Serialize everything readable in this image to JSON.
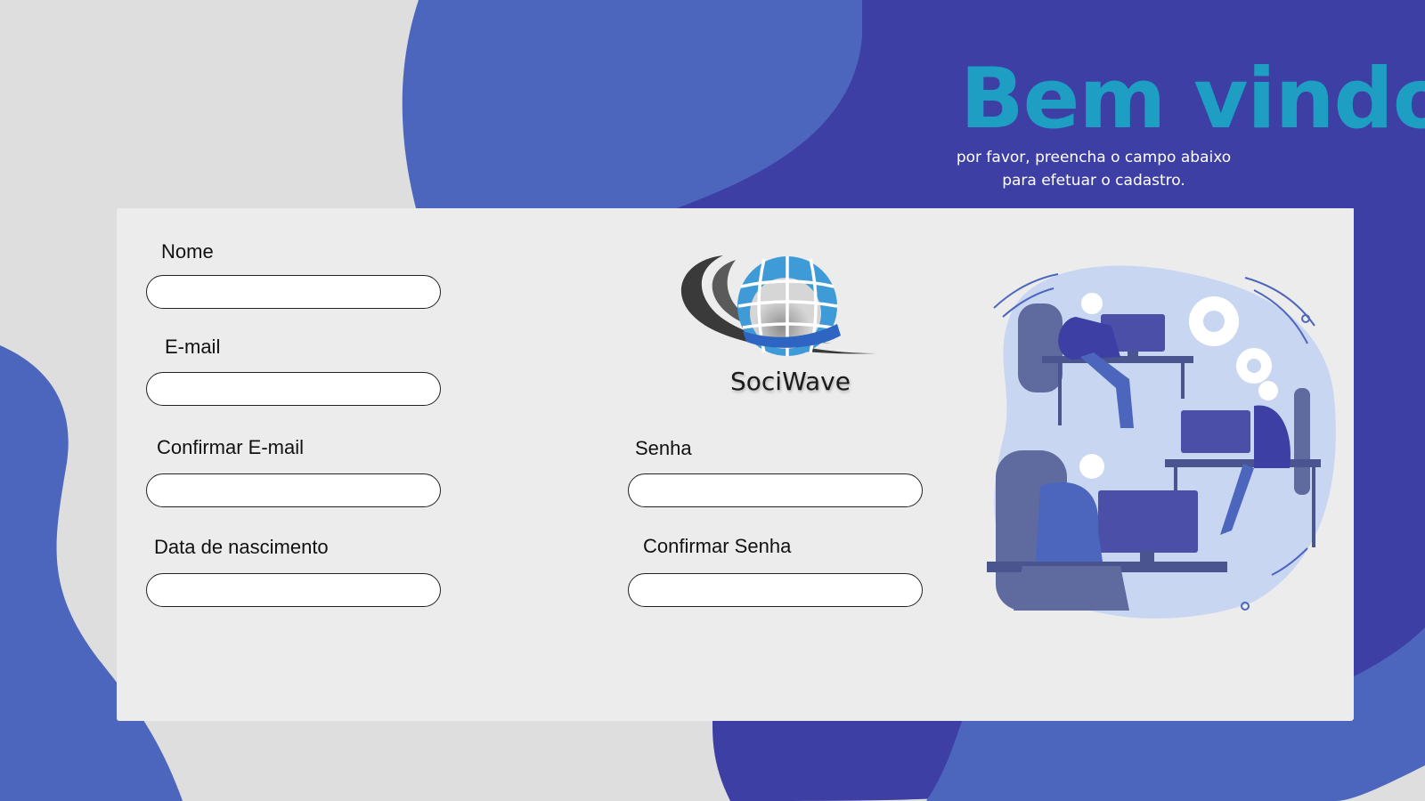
{
  "hero": {
    "title": "Bem vindo",
    "subtitle_line1": "por favor, preencha o campo abaixo",
    "subtitle_line2": "para efetuar o cadastro."
  },
  "brand": {
    "name": "SociWave",
    "logo_icon": "globe-icon"
  },
  "form": {
    "nome": {
      "label": "Nome",
      "value": "",
      "placeholder": ""
    },
    "email": {
      "label": "E-mail",
      "value": "",
      "placeholder": ""
    },
    "confirm_email": {
      "label": "Confirmar E-mail",
      "value": "",
      "placeholder": ""
    },
    "birth_date": {
      "label": "Data de nascimento",
      "value": "",
      "placeholder": ""
    },
    "senha": {
      "label": "Senha",
      "value": "",
      "placeholder": ""
    },
    "confirm_senha": {
      "label": "Confirmar Senha",
      "value": "",
      "placeholder": ""
    }
  },
  "illustration": {
    "icon": "people-at-computers-illustration"
  },
  "colors": {
    "background": "#dedede",
    "blob_light": "#4c66bd",
    "blob_dark": "#3d3fa4",
    "card": "#ececec",
    "title": "#1e9ec3"
  }
}
